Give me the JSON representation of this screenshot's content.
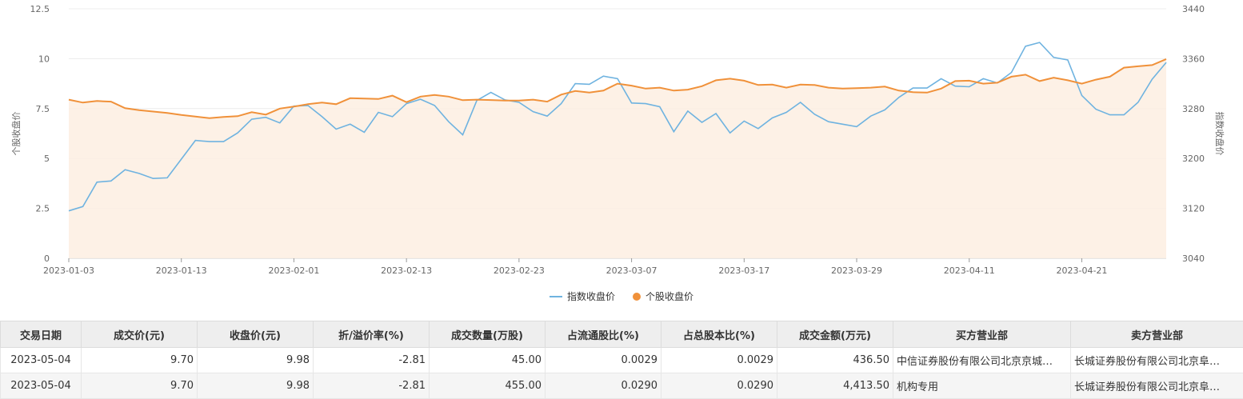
{
  "chart_data": {
    "type": "line",
    "x": [
      "2023-01-03",
      "2023-01-04",
      "2023-01-05",
      "2023-01-06",
      "2023-01-09",
      "2023-01-10",
      "2023-01-11",
      "2023-01-12",
      "2023-01-13",
      "2023-01-16",
      "2023-01-17",
      "2023-01-18",
      "2023-01-19",
      "2023-01-20",
      "2023-01-30",
      "2023-01-31",
      "2023-02-01",
      "2023-02-02",
      "2023-02-03",
      "2023-02-06",
      "2023-02-07",
      "2023-02-08",
      "2023-02-09",
      "2023-02-10",
      "2023-02-13",
      "2023-02-14",
      "2023-02-15",
      "2023-02-16",
      "2023-02-17",
      "2023-02-20",
      "2023-02-21",
      "2023-02-22",
      "2023-02-23",
      "2023-02-24",
      "2023-02-27",
      "2023-02-28",
      "2023-03-01",
      "2023-03-02",
      "2023-03-03",
      "2023-03-06",
      "2023-03-07",
      "2023-03-08",
      "2023-03-09",
      "2023-03-10",
      "2023-03-13",
      "2023-03-14",
      "2023-03-15",
      "2023-03-16",
      "2023-03-17",
      "2023-03-20",
      "2023-03-21",
      "2023-03-22",
      "2023-03-23",
      "2023-03-24",
      "2023-03-27",
      "2023-03-28",
      "2023-03-29",
      "2023-03-30",
      "2023-03-31",
      "2023-04-03",
      "2023-04-04",
      "2023-04-06",
      "2023-04-07",
      "2023-04-10",
      "2023-04-11",
      "2023-04-12",
      "2023-04-13",
      "2023-04-14",
      "2023-04-17",
      "2023-04-18",
      "2023-04-19",
      "2023-04-20",
      "2023-04-21",
      "2023-04-24",
      "2023-04-25",
      "2023-04-26",
      "2023-04-27",
      "2023-04-28",
      "2023-05-04"
    ],
    "x_tick_labels": [
      "2023-01-03",
      "2023-01-13",
      "2023-02-01",
      "2023-02-13",
      "2023-02-23",
      "2023-03-07",
      "2023-03-17",
      "2023-03-29",
      "2023-04-11",
      "2023-04-21"
    ],
    "series": [
      {
        "name": "指数收盘价",
        "axis": "right",
        "color": "#6fb3e0",
        "values": [
          3116,
          3123,
          3162,
          3164,
          3182,
          3176,
          3168,
          3169,
          3199,
          3229,
          3227,
          3227,
          3241,
          3263,
          3266,
          3257,
          3284,
          3285,
          3267,
          3247,
          3255,
          3242,
          3274,
          3267,
          3288,
          3295,
          3285,
          3259,
          3238,
          3293,
          3306,
          3294,
          3290,
          3275,
          3268,
          3288,
          3320,
          3319,
          3332,
          3328,
          3289,
          3288,
          3283,
          3243,
          3276,
          3258,
          3272,
          3241,
          3260,
          3248,
          3265,
          3274,
          3290,
          3271,
          3259,
          3255,
          3251,
          3268,
          3278,
          3298,
          3313,
          3313,
          3328,
          3316,
          3315,
          3328,
          3321,
          3338,
          3380,
          3386,
          3362,
          3358,
          3301,
          3279,
          3270,
          3270,
          3290,
          3327,
          3354
        ]
      },
      {
        "name": "个股收盘价",
        "axis": "left",
        "color": "#f0913a",
        "values": [
          7.95,
          7.8,
          7.88,
          7.85,
          7.52,
          7.42,
          7.35,
          7.28,
          7.18,
          7.1,
          7.02,
          7.08,
          7.12,
          7.32,
          7.2,
          7.5,
          7.6,
          7.72,
          7.8,
          7.72,
          8.02,
          8.0,
          7.98,
          8.15,
          7.82,
          8.1,
          8.18,
          8.1,
          7.92,
          7.95,
          7.93,
          7.9,
          7.9,
          7.95,
          7.85,
          8.2,
          8.38,
          8.3,
          8.4,
          8.75,
          8.65,
          8.5,
          8.55,
          8.4,
          8.45,
          8.62,
          8.92,
          9.0,
          8.9,
          8.68,
          8.7,
          8.55,
          8.7,
          8.68,
          8.55,
          8.5,
          8.52,
          8.55,
          8.6,
          8.4,
          8.32,
          8.3,
          8.5,
          8.88,
          8.9,
          8.75,
          8.8,
          9.1,
          9.2,
          8.88,
          9.05,
          8.92,
          8.75,
          8.95,
          9.1,
          9.55,
          9.62,
          9.68,
          9.98
        ]
      }
    ],
    "left_axis": {
      "label": "个股收盘价",
      "ylim": [
        0,
        12.5
      ],
      "ticks": [
        "0",
        "2.5",
        "5",
        "7.5",
        "10",
        "12.5"
      ]
    },
    "right_axis": {
      "label": "指数收盘价",
      "ylim": [
        3040,
        3440
      ],
      "ticks": [
        "3040",
        "3120",
        "3200",
        "3280",
        "3360",
        "3440"
      ]
    },
    "grid": true,
    "legend_position": "bottom"
  },
  "legend": [
    {
      "label": "指数收盘价",
      "color": "#6fb3e0"
    },
    {
      "label": "个股收盘价",
      "color": "#f0913a"
    }
  ],
  "table": {
    "headers": [
      "交易日期",
      "成交价(元)",
      "收盘价(元)",
      "折/溢价率(%)",
      "成交数量(万股)",
      "占流通股比(%)",
      "占总股本比(%)",
      "成交金额(万元)",
      "买方营业部",
      "卖方营业部"
    ],
    "rows": [
      [
        "2023-05-04",
        "9.70",
        "9.98",
        "-2.81",
        "45.00",
        "0.0029",
        "0.0029",
        "436.50",
        "中信证券股份有限公司北京京城…",
        "长城证券股份有限公司北京阜…"
      ],
      [
        "2023-05-04",
        "9.70",
        "9.98",
        "-2.81",
        "455.00",
        "0.0290",
        "0.0290",
        "4,413.50",
        "机构专用",
        "长城证券股份有限公司北京阜…"
      ]
    ]
  }
}
